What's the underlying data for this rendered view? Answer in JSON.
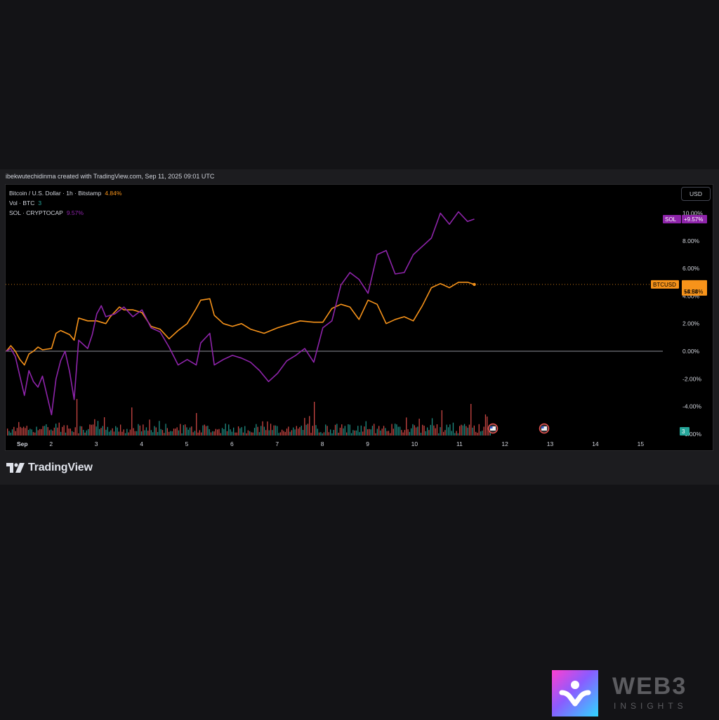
{
  "credit": "ibekwutechidinma created with TradingView.com, Sep 11, 2025 09:01 UTC",
  "legend": {
    "main_label": "Bitcoin / U.S. Dollar · 1h · Bitstamp",
    "main_value": "4.84%",
    "vol_label": "Vol · BTC",
    "vol_value": "3",
    "sol_label": "SOL · CRYPTOCAP",
    "sol_value": "9.57%"
  },
  "currency_button": "USD",
  "brand": {
    "name": "TradingView"
  },
  "watermark": {
    "title": "WEB3",
    "subtitle": "INSIGHTS"
  },
  "colors": {
    "btc": "#f7931a",
    "sol": "#8e24aa",
    "vol_up": "#26a69a",
    "vol_down": "#ef5350",
    "grid_zero": "#b2b5be"
  },
  "chart_data": {
    "type": "line",
    "x_tick_labels": [
      "Sep",
      "2",
      "3",
      "4",
      "5",
      "6",
      "7",
      "8",
      "9",
      "10",
      "11",
      "12",
      "13",
      "14",
      "15"
    ],
    "x_range_days": [
      1,
      15.5
    ],
    "y_tick_labels": [
      "10.00%",
      "8.00%",
      "6.00%",
      "4.00%",
      "2.00%",
      "0.00%",
      "-2.00%",
      "-4.00%",
      "-6.00%"
    ],
    "ylim": [
      -6,
      10.5
    ],
    "series": [
      {
        "name": "BTCUSD",
        "color": "#f7931a",
        "last_label": "+4.84%",
        "countdown": "58:58",
        "points": [
          [
            1.0,
            0.0
          ],
          [
            1.1,
            0.4
          ],
          [
            1.2,
            0.0
          ],
          [
            1.3,
            -0.6
          ],
          [
            1.4,
            -1.0
          ],
          [
            1.5,
            -0.2
          ],
          [
            1.6,
            0.0
          ],
          [
            1.7,
            0.3
          ],
          [
            1.8,
            0.1
          ],
          [
            2.0,
            0.2
          ],
          [
            2.1,
            1.3
          ],
          [
            2.2,
            1.5
          ],
          [
            2.4,
            1.2
          ],
          [
            2.5,
            0.8
          ],
          [
            2.6,
            2.4
          ],
          [
            2.8,
            2.2
          ],
          [
            3.0,
            2.2
          ],
          [
            3.2,
            2.0
          ],
          [
            3.3,
            2.5
          ],
          [
            3.5,
            3.2
          ],
          [
            3.6,
            3.0
          ],
          [
            3.8,
            3.0
          ],
          [
            4.0,
            2.8
          ],
          [
            4.2,
            1.8
          ],
          [
            4.4,
            1.6
          ],
          [
            4.6,
            0.9
          ],
          [
            4.8,
            1.5
          ],
          [
            5.0,
            2.0
          ],
          [
            5.2,
            3.1
          ],
          [
            5.3,
            3.7
          ],
          [
            5.5,
            3.8
          ],
          [
            5.6,
            2.6
          ],
          [
            5.8,
            2.0
          ],
          [
            6.0,
            1.8
          ],
          [
            6.2,
            2.0
          ],
          [
            6.4,
            1.6
          ],
          [
            6.7,
            1.3
          ],
          [
            7.0,
            1.7
          ],
          [
            7.3,
            2.0
          ],
          [
            7.5,
            2.2
          ],
          [
            7.8,
            2.1
          ],
          [
            8.0,
            2.1
          ],
          [
            8.2,
            3.1
          ],
          [
            8.4,
            3.4
          ],
          [
            8.6,
            3.2
          ],
          [
            8.8,
            2.3
          ],
          [
            9.0,
            3.7
          ],
          [
            9.2,
            3.4
          ],
          [
            9.4,
            2.0
          ],
          [
            9.6,
            2.3
          ],
          [
            9.8,
            2.5
          ],
          [
            10.0,
            2.2
          ],
          [
            10.2,
            3.3
          ],
          [
            10.4,
            4.6
          ],
          [
            10.6,
            4.9
          ],
          [
            10.8,
            4.6
          ],
          [
            11.0,
            5.0
          ],
          [
            11.2,
            5.0
          ],
          [
            11.35,
            4.84
          ]
        ]
      },
      {
        "name": "SOL",
        "color": "#8e24aa",
        "last_label": "+9.57%",
        "points": [
          [
            1.0,
            0.0
          ],
          [
            1.1,
            0.2
          ],
          [
            1.2,
            -0.4
          ],
          [
            1.3,
            -1.8
          ],
          [
            1.4,
            -3.2
          ],
          [
            1.5,
            -1.4
          ],
          [
            1.6,
            -2.2
          ],
          [
            1.7,
            -2.6
          ],
          [
            1.8,
            -1.8
          ],
          [
            2.0,
            -4.6
          ],
          [
            2.1,
            -2.0
          ],
          [
            2.2,
            -0.7
          ],
          [
            2.3,
            0.0
          ],
          [
            2.4,
            -1.5
          ],
          [
            2.5,
            -3.5
          ],
          [
            2.6,
            0.8
          ],
          [
            2.8,
            0.2
          ],
          [
            2.9,
            1.2
          ],
          [
            3.0,
            2.7
          ],
          [
            3.1,
            3.3
          ],
          [
            3.2,
            2.5
          ],
          [
            3.4,
            2.7
          ],
          [
            3.6,
            3.2
          ],
          [
            3.8,
            2.5
          ],
          [
            4.0,
            3.0
          ],
          [
            4.2,
            1.7
          ],
          [
            4.4,
            1.4
          ],
          [
            4.6,
            0.3
          ],
          [
            4.8,
            -1.0
          ],
          [
            5.0,
            -0.6
          ],
          [
            5.2,
            -1.0
          ],
          [
            5.3,
            0.6
          ],
          [
            5.5,
            1.3
          ],
          [
            5.6,
            -1.0
          ],
          [
            5.8,
            -0.6
          ],
          [
            6.0,
            -0.3
          ],
          [
            6.2,
            -0.5
          ],
          [
            6.4,
            -0.8
          ],
          [
            6.6,
            -1.4
          ],
          [
            6.8,
            -2.2
          ],
          [
            7.0,
            -1.6
          ],
          [
            7.2,
            -0.7
          ],
          [
            7.4,
            -0.3
          ],
          [
            7.6,
            0.2
          ],
          [
            7.8,
            -0.8
          ],
          [
            8.0,
            1.7
          ],
          [
            8.2,
            2.2
          ],
          [
            8.4,
            4.8
          ],
          [
            8.6,
            5.7
          ],
          [
            8.8,
            5.2
          ],
          [
            9.0,
            4.2
          ],
          [
            9.2,
            7.0
          ],
          [
            9.4,
            7.3
          ],
          [
            9.6,
            5.6
          ],
          [
            9.8,
            5.7
          ],
          [
            10.0,
            7.0
          ],
          [
            10.2,
            7.6
          ],
          [
            10.4,
            8.2
          ],
          [
            10.6,
            10.0
          ],
          [
            10.8,
            9.2
          ],
          [
            11.0,
            10.1
          ],
          [
            11.2,
            9.4
          ],
          [
            11.35,
            9.57
          ]
        ]
      }
    ],
    "volume_bars": "decorative histogram of hourly BTC volume, colored green (up) and red (down)",
    "vol_badge": "3"
  }
}
